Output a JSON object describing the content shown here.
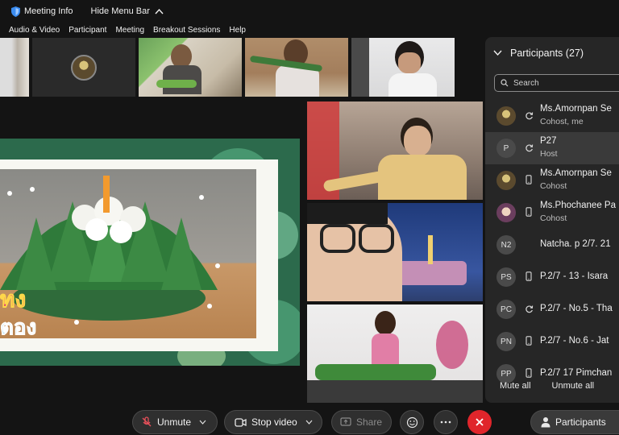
{
  "top": {
    "meeting_info": "Meeting Info",
    "hide_menu_bar": "Hide Menu Bar"
  },
  "menu": [
    "Audio & Video",
    "Participant",
    "Meeting",
    "Breakout Sessions",
    "Help"
  ],
  "stage": {
    "caption_line1": "ทง",
    "caption_line2": "ตอง"
  },
  "participants": {
    "title": "Participants (27)",
    "search_placeholder": "Search",
    "list": [
      {
        "initials": "",
        "avatar": "img1",
        "icon": "sync-icon",
        "name": "Ms.Amornpan Se",
        "role": "Cohost, me"
      },
      {
        "initials": "P",
        "avatar": "",
        "icon": "sync-icon",
        "name": "P27",
        "role": "Host",
        "selected": true
      },
      {
        "initials": "",
        "avatar": "img1",
        "icon": "phone-icon",
        "name": "Ms.Amornpan Se",
        "role": "Cohost"
      },
      {
        "initials": "",
        "avatar": "img2",
        "icon": "phone-icon",
        "name": "Ms.Phochanee Pa",
        "role": "Cohost"
      },
      {
        "initials": "N2",
        "avatar": "",
        "icon": "",
        "name": "Natcha. p 2/7. 21",
        "role": ""
      },
      {
        "initials": "PS",
        "avatar": "",
        "icon": "phone-icon",
        "name": "P.2/7 - 13 - Isara",
        "role": ""
      },
      {
        "initials": "PC",
        "avatar": "",
        "icon": "sync-icon",
        "name": "P.2/7 - No.5 - Tha",
        "role": ""
      },
      {
        "initials": "PN",
        "avatar": "",
        "icon": "phone-icon",
        "name": "P.2/7 - No.6 - Jat",
        "role": ""
      },
      {
        "initials": "PP",
        "avatar": "",
        "icon": "phone-icon",
        "name": "P.2/7 17 Pimchan",
        "role": ""
      }
    ],
    "mute_all": "Mute all",
    "unmute_all": "Unmute all"
  },
  "controls": {
    "unmute": "Unmute",
    "stop_video": "Stop video",
    "share": "Share",
    "participants": "Participants",
    "leave_color": "#e0252b"
  }
}
